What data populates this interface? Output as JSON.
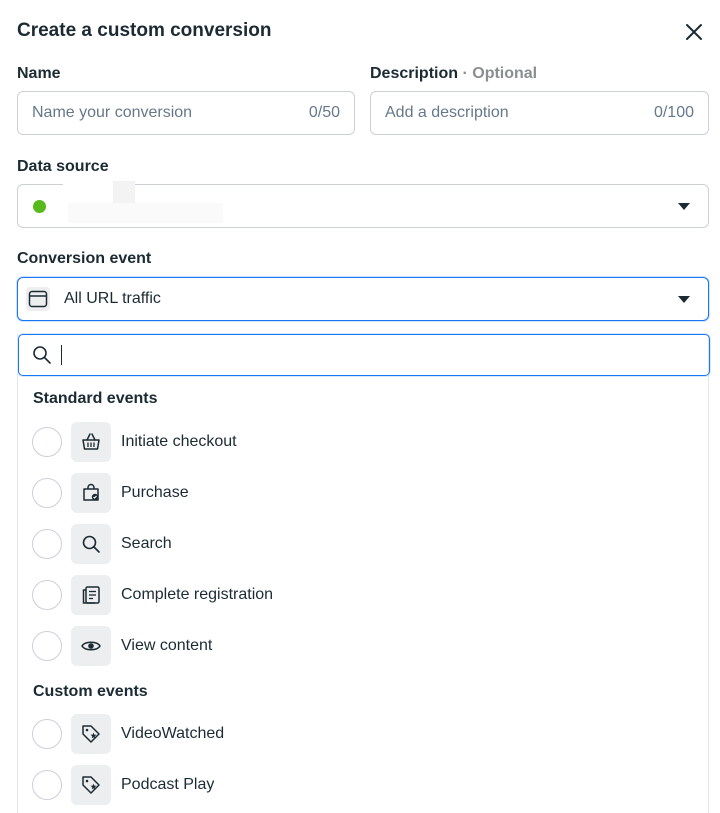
{
  "dialog": {
    "title": "Create a custom conversion"
  },
  "name_field": {
    "label": "Name",
    "placeholder": "Name your conversion",
    "value": "",
    "counter": "0/50"
  },
  "description_field": {
    "label": "Description",
    "optional": "· Optional",
    "placeholder": "Add a description",
    "value": "",
    "counter": "0/100"
  },
  "data_source": {
    "label": "Data source",
    "status_color": "#58b91c"
  },
  "conversion_event": {
    "label": "Conversion event",
    "selected": "All URL traffic",
    "selected_icon": "browser-window-icon"
  },
  "dropdown": {
    "search_placeholder": "",
    "sections": [
      {
        "title": "Standard events",
        "items": [
          {
            "label": "Initiate checkout",
            "icon": "basket-icon"
          },
          {
            "label": "Purchase",
            "icon": "shopping-bag-icon"
          },
          {
            "label": "Search",
            "icon": "search-icon"
          },
          {
            "label": "Complete registration",
            "icon": "registration-form-icon"
          },
          {
            "label": "View content",
            "icon": "eye-icon"
          }
        ]
      },
      {
        "title": "Custom events",
        "items": [
          {
            "label": "VideoWatched",
            "icon": "tag-icon"
          },
          {
            "label": "Podcast Play",
            "icon": "tag-icon"
          }
        ]
      }
    ]
  },
  "colors": {
    "accent": "#1877f2",
    "text": "#1c2b33",
    "muted": "#67788a",
    "border": "#ccd0d5"
  }
}
